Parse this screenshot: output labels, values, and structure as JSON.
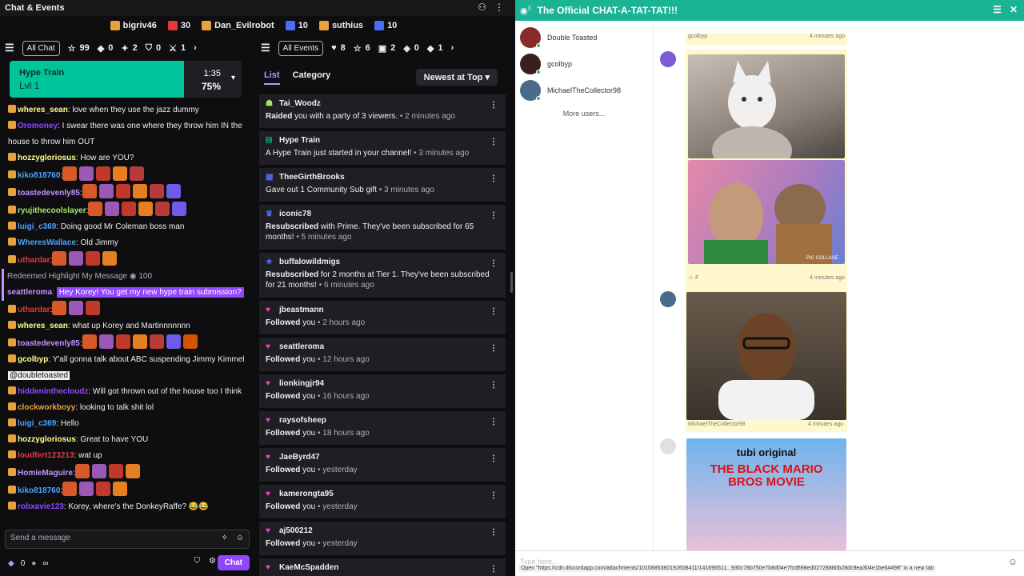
{
  "topbar": {
    "title": "Chat & Events",
    "stats": [
      {
        "name": "bigriv46",
        "value": "",
        "color": "#e6a23c"
      },
      {
        "name": "",
        "value": "30",
        "color": "#e53935"
      },
      {
        "name": "Dan_Evilrobot",
        "value": "",
        "color": "#e6a23c"
      },
      {
        "name": "",
        "value": "10",
        "color": "#4a6cf7"
      },
      {
        "name": "suthius",
        "value": "",
        "color": "#e6a23c"
      },
      {
        "name": "",
        "value": "10",
        "color": "#4a6cf7"
      }
    ]
  },
  "chat_filters": {
    "pill": "All Chat",
    "counts": [
      "99",
      "0",
      "2",
      "0",
      "1"
    ]
  },
  "event_filters": {
    "pill": "All Events",
    "counts": [
      "8",
      "6",
      "2",
      "0",
      "1"
    ]
  },
  "hype_train": {
    "title": "Hype Train",
    "level": "Lvl 1",
    "time": "1:35",
    "percent": "75%",
    "progress": 0.75
  },
  "chat": {
    "messages": [
      {
        "user": "wheres_sean",
        "color": "#ffff88",
        "text": ": love when they use the jazz dummy",
        "emotes": 0
      },
      {
        "user": "Oromoney",
        "color": "#9147ff",
        "text": ": I swear there was one where they throw him IN the house to throw him OUT",
        "emotes": 0
      },
      {
        "user": "hozzygloriosus",
        "color": "#ffff88",
        "text": ": How are YOU?",
        "emotes": 0
      },
      {
        "user": "kiko818760",
        "color": "#4aa3ff",
        "text": ":",
        "emotes": 5
      },
      {
        "user": "toastedevenly85",
        "color": "#bf94ff",
        "text": ":",
        "emotes": 6
      },
      {
        "user": "ryujithecoolslayer",
        "color": "#a4e66b",
        "text": ":",
        "emotes": 6
      },
      {
        "user": "luigi_c369",
        "color": "#4aa3ff",
        "text": ": Doing good Mr Coleman boss man",
        "emotes": 0
      },
      {
        "user": "WheresWallace",
        "color": "#4aa3ff",
        "text": ": Old Jimmy",
        "emotes": 0
      },
      {
        "user": "uthardar",
        "color": "#e53935",
        "text": ":",
        "emotes": 4
      }
    ],
    "redeem": {
      "label": "Redeemed Highlight My Message",
      "cost": "100"
    },
    "highlight": {
      "user": "seattleroma",
      "color": "#bf94ff",
      "text": "Hey Korey! You get my new hype train submission?"
    },
    "messages2": [
      {
        "user": "uthardar",
        "color": "#e53935",
        "text": ":",
        "emotes": 3
      },
      {
        "user": "wheres_sean",
        "color": "#ffff88",
        "text": ": what up Korey and Martinnnnnnn",
        "emotes": 0
      },
      {
        "user": "toastedevenly85",
        "color": "#bf94ff",
        "text": ":",
        "emotes": 7
      },
      {
        "user": "gcolbyp",
        "color": "#ffff88",
        "text": ": Y'all gonna talk about ABC suspending Jimmy Kimmel",
        "mention": "@doubletoasted",
        "emotes": 0
      },
      {
        "user": "hiddeninthecloudz",
        "color": "#9147ff",
        "text": ": Will got thrown out of the house too I think",
        "emotes": 0
      },
      {
        "user": "clockworkboyy",
        "color": "#e6a23c",
        "text": ": looking to talk shit lol",
        "emotes": 0
      },
      {
        "user": "luigi_c369",
        "color": "#4aa3ff",
        "text": ": Hello",
        "emotes": 0
      },
      {
        "user": "hozzygloriosus",
        "color": "#ffff88",
        "text": ": Great to have YOU",
        "emotes": 0
      },
      {
        "user": "loudfert123213",
        "color": "#e53935",
        "text": ": wat up",
        "emotes": 0
      },
      {
        "user": "HomieMaguire",
        "color": "#bf94ff",
        "text": ":",
        "emotes": 4
      },
      {
        "user": "kiko818760",
        "color": "#4aa3ff",
        "text": ":",
        "emotes": 4
      },
      {
        "user": "robxavie123",
        "color": "#9147ff",
        "text": ": Korey, where's the DonkeyRaffe? 😂😂",
        "emotes": 0
      }
    ],
    "send_placeholder": "Send a message",
    "points": "0",
    "infinity": "∞",
    "chat_button": "Chat"
  },
  "events": {
    "tabs": [
      "List",
      "Category"
    ],
    "sort": "Newest at Top",
    "items": [
      {
        "name": "Tai_Woodz",
        "icon": "raid-icon",
        "color": "#a4e66b",
        "desc_bold": "Raided",
        "desc": " you with a party of 3 viewers.",
        "time": " • 2 minutes ago",
        "tall": false
      },
      {
        "name": "Hype Train",
        "icon": "train-icon",
        "color": "#00c49a",
        "desc_bold": "",
        "desc": "A Hype Train just started in your channel!",
        "time": " • 3 minutes ago",
        "tall": false
      },
      {
        "name": "TheeGirthBrooks",
        "icon": "gift-icon",
        "color": "#4a6cf7",
        "desc_bold": "",
        "desc": "Gave out 1 Community Sub gift",
        "time": " • 3 minutes ago",
        "tall": false
      },
      {
        "name": "iconic78",
        "icon": "crown-icon",
        "color": "#4a6cf7",
        "desc_bold": "Resubscribed",
        "desc": " with Prime. They've been subscribed for 65 months!",
        "time": " • 5 minutes ago",
        "tall": true
      },
      {
        "name": "buffalowildmigs",
        "icon": "star-icon",
        "color": "#4a6cf7",
        "desc_bold": "Resubscribed",
        "desc": " for 2 months at Tier 1. They've been subscribed for 21 months!",
        "time": " • 6 minutes ago",
        "tall": true
      },
      {
        "name": "jbeastmann",
        "icon": "heart-icon",
        "color": "#ff3fbf",
        "desc_bold": "Followed",
        "desc": " you",
        "time": " • 2 hours ago",
        "tall": false
      },
      {
        "name": "seattleroma",
        "icon": "heart-icon",
        "color": "#ff3fbf",
        "desc_bold": "Followed",
        "desc": " you",
        "time": " • 12 hours ago",
        "tall": false
      },
      {
        "name": "lionkingjr94",
        "icon": "heart-icon",
        "color": "#ff3fbf",
        "desc_bold": "Followed",
        "desc": " you",
        "time": " • 16 hours ago",
        "tall": false
      },
      {
        "name": "raysofsheep",
        "icon": "heart-icon",
        "color": "#ff3fbf",
        "desc_bold": "Followed",
        "desc": " you",
        "time": " • 18 hours ago",
        "tall": false
      },
      {
        "name": "JaeByrd47",
        "icon": "heart-icon",
        "color": "#ff3fbf",
        "desc_bold": "Followed",
        "desc": " you",
        "time": " • yesterday",
        "tall": false
      },
      {
        "name": "kamerongta95",
        "icon": "heart-icon",
        "color": "#ff3fbf",
        "desc_bold": "Followed",
        "desc": " you",
        "time": " • yesterday",
        "tall": false
      },
      {
        "name": "aj500212",
        "icon": "heart-icon",
        "color": "#ff3fbf",
        "desc_bold": "Followed",
        "desc": " you",
        "time": " • yesterday",
        "tall": false
      },
      {
        "name": "KaeMcSpadden",
        "icon": "heart-icon",
        "color": "#ff3fbf",
        "desc_bold": "",
        "desc": "",
        "time": "",
        "tall": false
      }
    ]
  },
  "discord": {
    "badge": "3",
    "title": "The Official CHAT-A-TAT-TAT!!!",
    "users": [
      {
        "name": "Double Toasted",
        "color": "#8a2b2b"
      },
      {
        "name": "gcolbyp",
        "color": "#3a1f1f"
      },
      {
        "name": "MichaelTheCollector98",
        "color": "#4b6a8a"
      }
    ],
    "more_users": "More users...",
    "posts": [
      {
        "author": "gcolbyp",
        "time": "4 minutes ago"
      },
      {
        "author": "F",
        "time": "4 minutes ago"
      },
      {
        "author": "MichaelTheCollector98",
        "time": "4 minutes ago"
      }
    ],
    "poster": {
      "brand": "tubi original",
      "title": "THE BLACK MARIO BROS MOVIE"
    },
    "collage_label": "PIC COLLAGE",
    "input_placeholder": "Type here...",
    "status_url": "Open \"https://cdn.discordapp.com/attachments/1010885380192608411/141696511...930c78b750e7b8d04e7fcd698ed02728880b28dc9ea304e1be64498\" in a new tab"
  }
}
